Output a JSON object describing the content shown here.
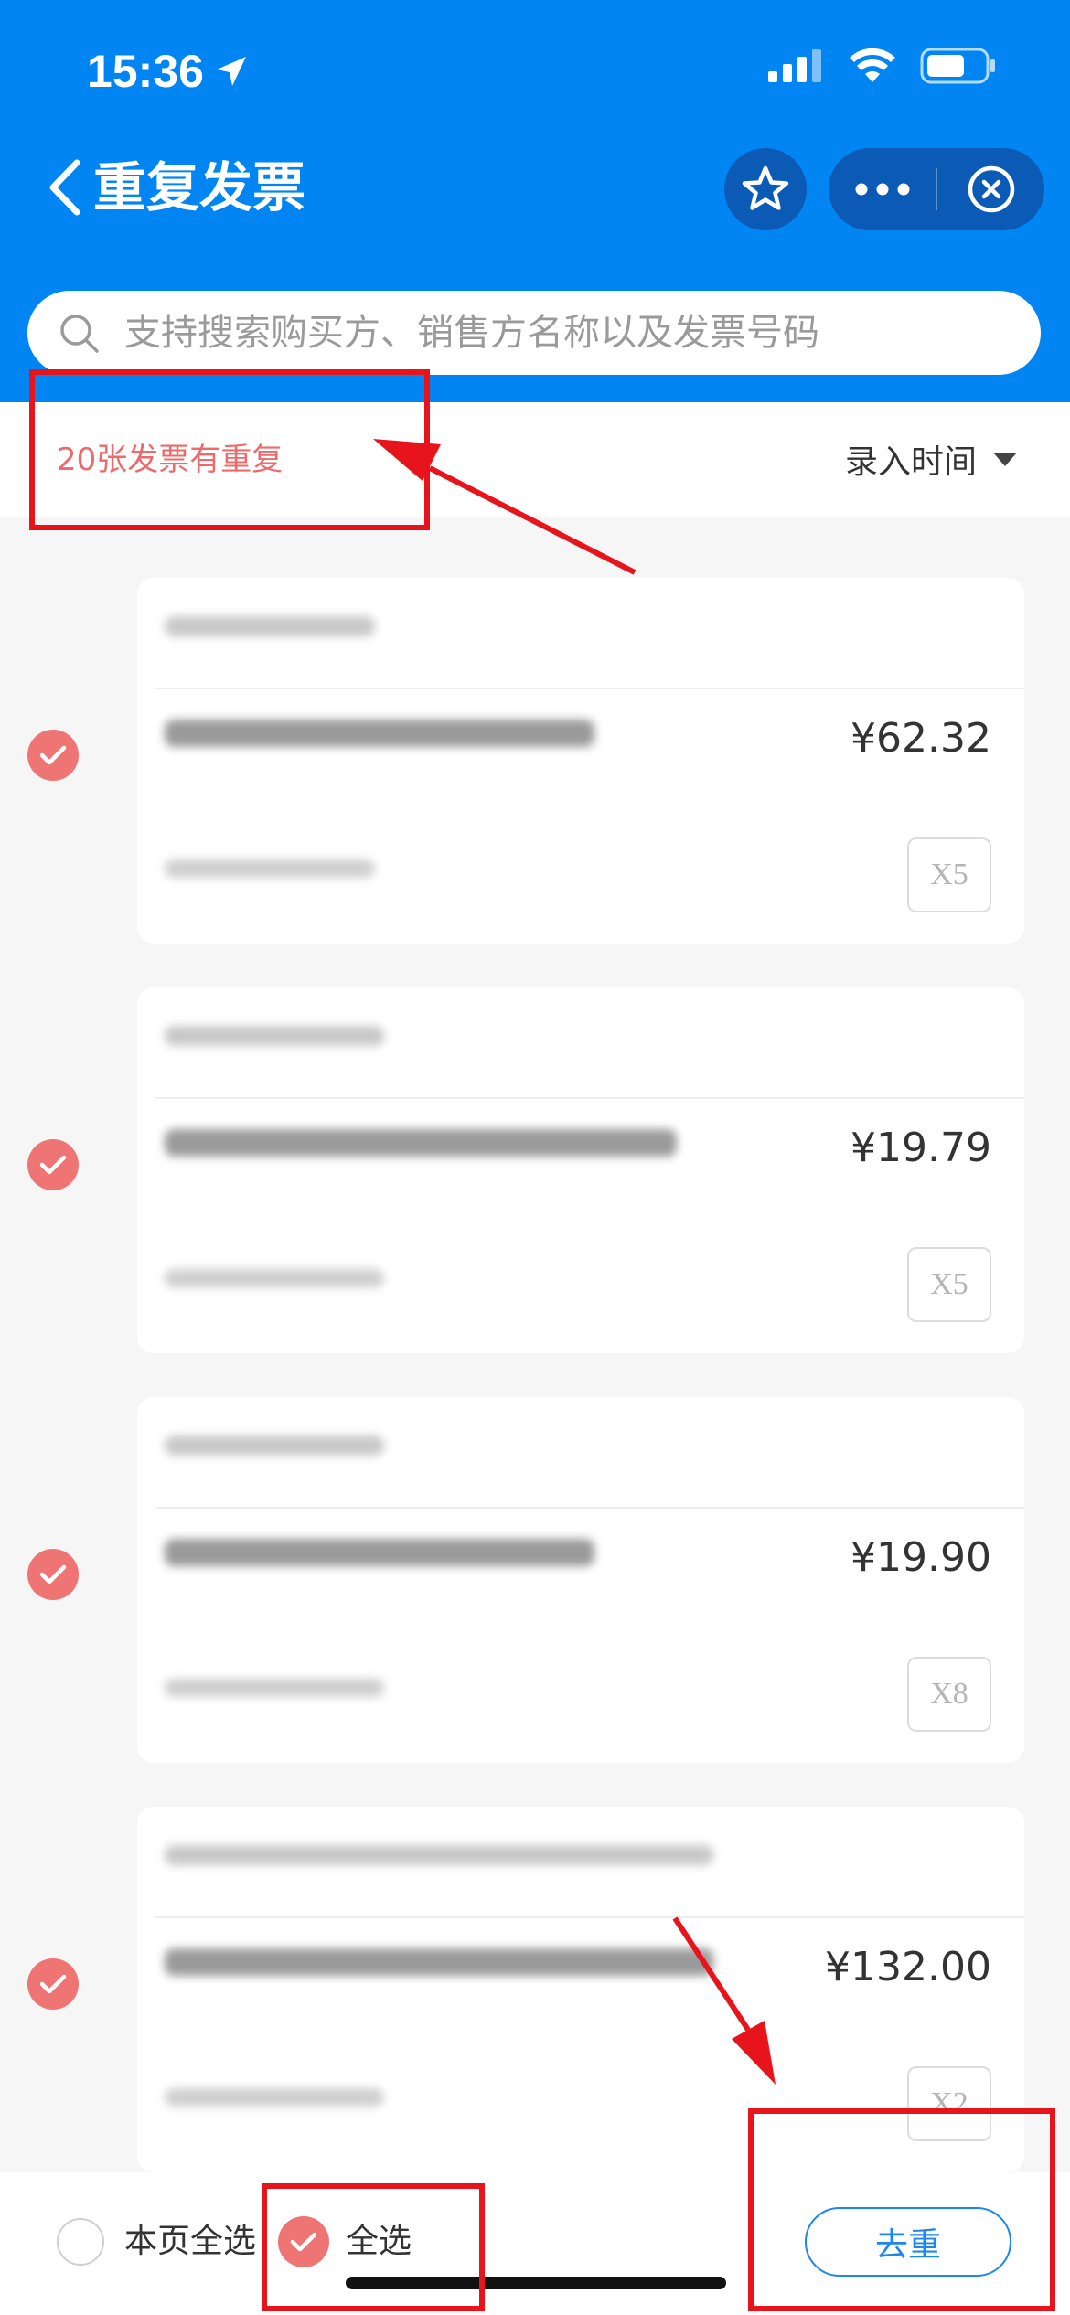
{
  "status_bar": {
    "time": "15:36"
  },
  "nav": {
    "title": "重复发票"
  },
  "search": {
    "placeholder": "支持搜索购买方、销售方名称以及发票号码"
  },
  "filter": {
    "duplicate_count": "20张发票有重复",
    "sort_label": "录入时间"
  },
  "invoices": [
    {
      "amount": "¥62.32",
      "quantity": "X5",
      "checked": true
    },
    {
      "amount": "¥19.79",
      "quantity": "X5",
      "checked": true
    },
    {
      "amount": "¥19.90",
      "quantity": "X8",
      "checked": true
    },
    {
      "amount": "¥132.00",
      "quantity": "X2",
      "checked": true
    }
  ],
  "bottom": {
    "select_page_label": "本页全选",
    "select_all_label": "全选",
    "select_all_checked": true,
    "select_page_checked": false,
    "dedupe_button": "去重"
  },
  "colors": {
    "header": "#0085f2",
    "accent_red": "#ef7474",
    "button_blue": "#1c87ee",
    "annotation_red": "#e8141c"
  }
}
